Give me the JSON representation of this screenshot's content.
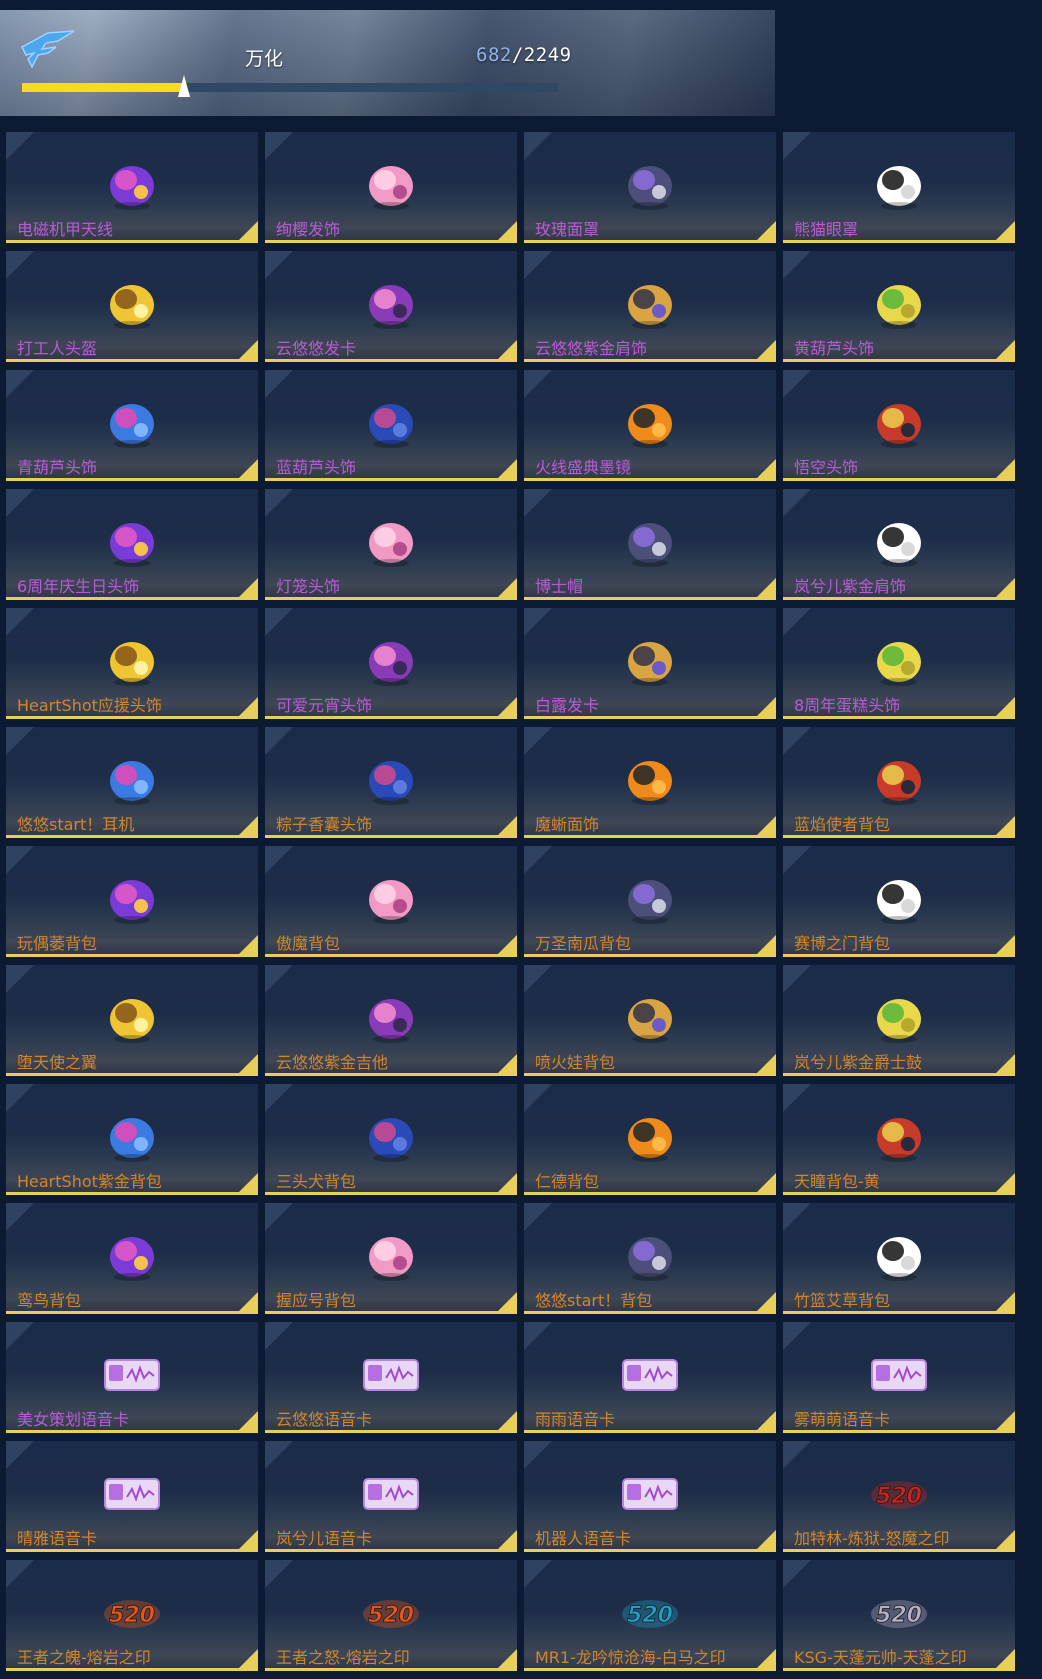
{
  "header": {
    "account_name": "万化",
    "count_current": "682",
    "count_separator": "/",
    "count_total": "2249",
    "progress": 0.303
  },
  "colors": {
    "accent_yellow": "#e8cf5a",
    "progress_yellow": "#f5dd1e",
    "label_purple": "#b85ad6",
    "label_orange": "#d0862a"
  },
  "items": [
    {
      "label": "电磁机甲天线",
      "color": "#b85ad6",
      "icon": "antenna-icon"
    },
    {
      "label": "绚樱发饰",
      "color": "#b85ad6",
      "icon": "cherry-blossom-icon"
    },
    {
      "label": "玫瑰面罩",
      "color": "#b85ad6",
      "icon": "rose-mask-icon"
    },
    {
      "label": "熊猫眼罩",
      "color": "#b85ad6",
      "icon": "panda-icon"
    },
    {
      "label": "打工人头盔",
      "color": "#b85ad6",
      "icon": "hard-hat-icon"
    },
    {
      "label": "云悠悠发卡",
      "color": "#b85ad6",
      "icon": "hairpin-icon"
    },
    {
      "label": "云悠悠紫金肩饰",
      "color": "#b85ad6",
      "icon": "shoulder-ornament-icon"
    },
    {
      "label": "黄葫芦头饰",
      "color": "#b85ad6",
      "icon": "gourd-icon"
    },
    {
      "label": "青葫芦头饰",
      "color": "#b85ad6",
      "icon": "gourd-icon"
    },
    {
      "label": "蓝葫芦头饰",
      "color": "#b85ad6",
      "icon": "gourd-icon"
    },
    {
      "label": "火线盛典墨镜",
      "color": "#b85ad6",
      "icon": "sunglasses-icon"
    },
    {
      "label": "悟空头饰",
      "color": "#b85ad6",
      "icon": "monkey-king-headband-icon"
    },
    {
      "label": "6周年庆生日头饰",
      "color": "#b85ad6",
      "icon": "birthday-doll-icon"
    },
    {
      "label": "灯笼头饰",
      "color": "#b85ad6",
      "icon": "lantern-icon"
    },
    {
      "label": "博士帽",
      "color": "#b85ad6",
      "icon": "graduation-cap-icon"
    },
    {
      "label": "岚兮儿紫金肩饰",
      "color": "#b85ad6",
      "icon": "shoulder-ornament-icon"
    },
    {
      "label": "HeartShot应援头饰",
      "color": "#d0862a",
      "icon": "heartshot-sign-icon"
    },
    {
      "label": "可爱元宵头饰",
      "color": "#b85ad6",
      "icon": "rice-ball-icon"
    },
    {
      "label": "白露发卡",
      "color": "#b85ad6",
      "icon": "ginkgo-hairpin-icon"
    },
    {
      "label": "8周年蛋糕头饰",
      "color": "#b85ad6",
      "icon": "cake-icon"
    },
    {
      "label": "悠悠start！耳机",
      "color": "#d0862a",
      "icon": "headphones-icon"
    },
    {
      "label": "粽子香囊头饰",
      "color": "#d0862a",
      "icon": "sachet-icon"
    },
    {
      "label": "魔蜥面饰",
      "color": "#d0862a",
      "icon": "lizard-mask-icon"
    },
    {
      "label": "蓝焰使者背包",
      "color": "#d0862a",
      "icon": "backpack-icon"
    },
    {
      "label": "玩偶萎背包",
      "color": "#d0862a",
      "icon": "doll-backpack-icon"
    },
    {
      "label": "傲魔背包",
      "color": "#d0862a",
      "icon": "demon-backpack-icon"
    },
    {
      "label": "万圣南瓜背包",
      "color": "#d0862a",
      "icon": "pumpkin-icon"
    },
    {
      "label": "赛博之门背包",
      "color": "#d0862a",
      "icon": "cyber-backpack-icon"
    },
    {
      "label": "堕天使之翼",
      "color": "#d0862a",
      "icon": "wings-icon"
    },
    {
      "label": "云悠悠紫金吉他",
      "color": "#d0862a",
      "icon": "guitar-icon"
    },
    {
      "label": "喷火娃背包",
      "color": "#d0862a",
      "icon": "fire-doll-icon"
    },
    {
      "label": "岚兮儿紫金爵士鼓",
      "color": "#d0862a",
      "icon": "drum-icon"
    },
    {
      "label": "HeartShot紫金背包",
      "color": "#d0862a",
      "icon": "shield-backpack-icon"
    },
    {
      "label": "三头犬背包",
      "color": "#d0862a",
      "icon": "cerberus-icon"
    },
    {
      "label": "仁德背包",
      "color": "#d0862a",
      "icon": "mech-backpack-icon"
    },
    {
      "label": "天瞳背包-黄",
      "color": "#d0862a",
      "icon": "angel-backpack-icon"
    },
    {
      "label": "鸾鸟背包",
      "color": "#d0862a",
      "icon": "phoenix-icon"
    },
    {
      "label": "握应号背包",
      "color": "#d0862a",
      "icon": "rocket-icon"
    },
    {
      "label": "悠悠start！背包",
      "color": "#d0862a",
      "icon": "capsule-backpack-icon"
    },
    {
      "label": "竹篮艾草背包",
      "color": "#d0862a",
      "icon": "basket-icon"
    },
    {
      "label": "美女策划语音卡",
      "color": "#b85ad6",
      "icon": "voice-card-icon"
    },
    {
      "label": "云悠悠语音卡",
      "color": "#d0862a",
      "icon": "voice-card-icon"
    },
    {
      "label": "雨雨语音卡",
      "color": "#d0862a",
      "icon": "voice-card-icon"
    },
    {
      "label": "雾萌萌语音卡",
      "color": "#d0862a",
      "icon": "voice-card-icon"
    },
    {
      "label": "晴雅语音卡",
      "color": "#d0862a",
      "icon": "voice-card-icon"
    },
    {
      "label": "岚兮儿语音卡",
      "color": "#d0862a",
      "icon": "voice-card-icon"
    },
    {
      "label": "机器人语音卡",
      "color": "#d0862a",
      "icon": "voice-card-icon"
    },
    {
      "label": "加特林-炼狱-怒魔之印",
      "color": "#d0862a",
      "icon": "520-seal-icon"
    },
    {
      "label": "王者之魄-熔岩之印",
      "color": "#d0862a",
      "icon": "520-seal-icon"
    },
    {
      "label": "王者之怒-熔岩之印",
      "color": "#d0862a",
      "icon": "520-seal-icon"
    },
    {
      "label": "MR1-龙吟惊沧海-白马之印",
      "color": "#d0862a",
      "icon": "520-seal-icon"
    },
    {
      "label": "KSG-天蓬元帅-天蓬之印",
      "color": "#d0862a",
      "icon": "520-seal-icon"
    }
  ]
}
